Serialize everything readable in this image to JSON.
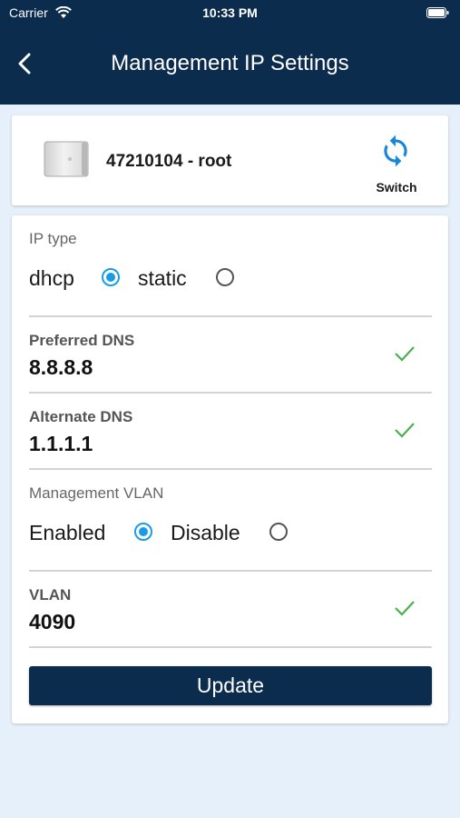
{
  "status_bar": {
    "carrier": "Carrier",
    "time": "10:33 PM"
  },
  "header": {
    "title": "Management IP Settings"
  },
  "device": {
    "name": "47210104 - root",
    "switch_label": "Switch"
  },
  "ip_type": {
    "label": "IP type",
    "options": [
      {
        "label": "dhcp",
        "selected": true
      },
      {
        "label": "static",
        "selected": false
      }
    ]
  },
  "preferred_dns": {
    "label": "Preferred DNS",
    "value": "8.8.8.8"
  },
  "alternate_dns": {
    "label": "Alternate DNS",
    "value": "1.1.1.1"
  },
  "management_vlan": {
    "label": "Management VLAN",
    "options": [
      {
        "label": "Enabled",
        "selected": true
      },
      {
        "label": "Disable",
        "selected": false
      }
    ]
  },
  "vlan": {
    "label": "VLAN",
    "value": "4090"
  },
  "update_button": {
    "label": "Update"
  },
  "colors": {
    "header_bg": "#0c2c4e",
    "accent": "#1a9be6",
    "check": "#4caf50",
    "background": "#e6f0fa"
  }
}
